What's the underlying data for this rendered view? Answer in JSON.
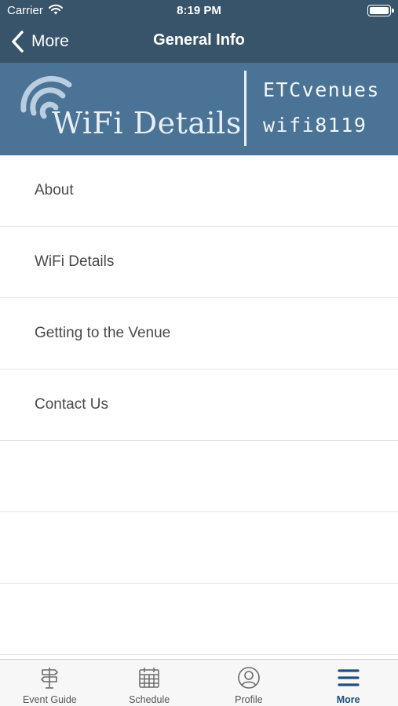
{
  "status_bar": {
    "carrier": "Carrier",
    "time": "8:19 PM"
  },
  "nav": {
    "back_label": "More",
    "title": "General Info"
  },
  "banner": {
    "heading": "WiFi Details",
    "network": "ETCvenues",
    "password": "wifi8119"
  },
  "menu": {
    "items": [
      {
        "label": "About"
      },
      {
        "label": "WiFi Details"
      },
      {
        "label": "Getting to the Venue"
      },
      {
        "label": "Contact Us"
      }
    ]
  },
  "tabs": [
    {
      "label": "Event Guide",
      "icon": "signpost-icon"
    },
    {
      "label": "Schedule",
      "icon": "calendar-icon"
    },
    {
      "label": "Profile",
      "icon": "profile-icon"
    },
    {
      "label": "More",
      "icon": "hamburger-menu-icon",
      "active": true
    }
  ],
  "colors": {
    "nav_bg": "#37546a",
    "banner_bg": "#4b7395",
    "active_tab": "#1f4f7a"
  }
}
